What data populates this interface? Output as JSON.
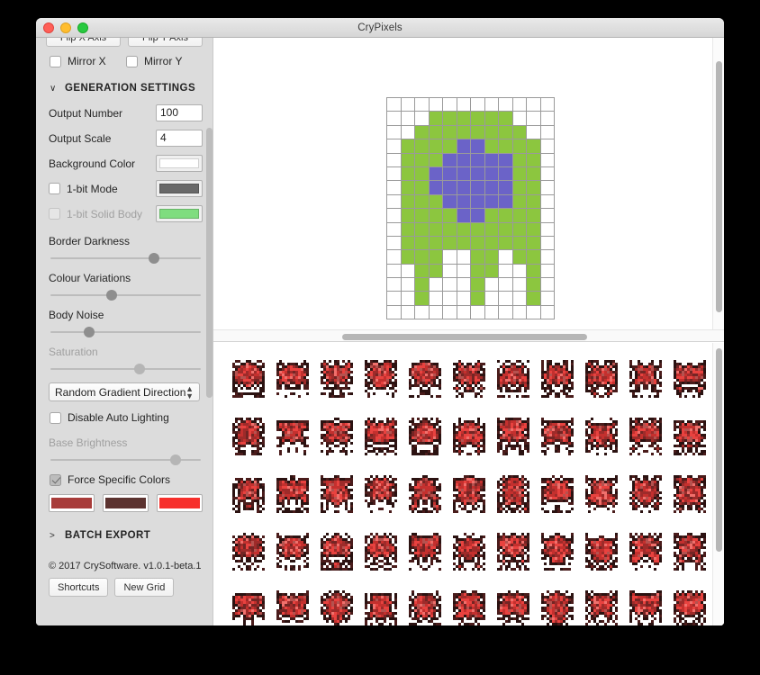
{
  "window": {
    "title": "CryPixels",
    "traffic_lights": [
      "close",
      "minimize",
      "maximize"
    ]
  },
  "sidebar": {
    "top_buttons": [
      {
        "label": "Flip X Axis",
        "name": "flip-x-axis-button"
      },
      {
        "label": "Flip Y Axis",
        "name": "flip-y-axis-button"
      }
    ],
    "mirror_checkboxes": [
      {
        "label": "Mirror X",
        "checked": false,
        "disabled": false
      },
      {
        "label": "Mirror Y",
        "checked": false,
        "disabled": false
      }
    ],
    "generation_settings": {
      "header": "GENERATION SETTINGS",
      "caret": "∨",
      "expanded": true,
      "fields": [
        {
          "label": "Output Number",
          "type": "text",
          "value": "100"
        },
        {
          "label": "Output Scale",
          "type": "text",
          "value": "4"
        },
        {
          "label": "Background Color",
          "type": "swatch",
          "color": "#ffffff"
        }
      ],
      "mode_rows": [
        {
          "label": "1-bit Mode",
          "checked": false,
          "disabled": false,
          "color": "#696969"
        },
        {
          "label": "1-bit Solid Body",
          "checked": false,
          "disabled": true,
          "color": "#7fdd7f"
        }
      ],
      "sliders": [
        {
          "label": "Border Darkness",
          "value": 69,
          "disabled": false
        },
        {
          "label": "Colour Variations",
          "value": 41,
          "disabled": false
        },
        {
          "label": "Body Noise",
          "value": 26,
          "disabled": false
        },
        {
          "label": "Saturation",
          "value": 59,
          "disabled": true
        }
      ],
      "gradient_select": {
        "value": "Random Gradient Direction",
        "options": [
          "Random Gradient Direction"
        ]
      },
      "disable_auto_lighting": {
        "label": "Disable Auto Lighting",
        "checked": false
      },
      "base_brightness": {
        "label": "Base Brightness",
        "value": 83,
        "disabled": true
      },
      "force_specific_colors": {
        "label": "Force Specific Colors",
        "checked": true
      },
      "forced_colors": [
        "#a83c3a",
        "#5c3330",
        "#f7302c"
      ]
    },
    "batch_export": {
      "header": "BATCH EXPORT",
      "caret": ">",
      "expanded": false
    },
    "footer": {
      "copyright": "© 2017 CrySoftware. v1.0.1-beta.1",
      "buttons": [
        {
          "label": "Shortcuts"
        },
        {
          "label": "New Grid"
        }
      ]
    }
  },
  "editor": {
    "grid": {
      "columns": 12,
      "rows": 16,
      "palette": {
        "empty": "#ffffff",
        "body": "#8cc63f",
        "core": "#6b63c8"
      },
      "cells": [
        "............",
        "...bbbbbb...",
        "..bbbbbbbb..",
        ".bbbbccbbbb.",
        ".bbbcccccbb.",
        ".bbccccccbb.",
        ".bbccccccbb.",
        ".bbbcccccbb.",
        ".bbbbccbbbb.",
        ".bbbbbbbbbb.",
        ".bbbbbbbbbb.",
        ".bbb..bb.bb.",
        "..bb..bb..b.",
        "..b...b...b.",
        "..b...b...b.",
        "............"
      ]
    },
    "hscrollbar": {
      "position": 40,
      "size": 65
    },
    "vscrollbar": {
      "position": 8,
      "size": 86
    }
  },
  "results": {
    "columns": 11,
    "rows": 5,
    "count": 55,
    "palette": [
      "#e8423f",
      "#c4302e",
      "#9e2b2a",
      "#742524",
      "#4a1c1b",
      "#2b1211",
      "#f0706c",
      "#b5524f",
      "#8a3f3d"
    ],
    "vscrollbar": {
      "position": 2,
      "size": 72
    }
  }
}
